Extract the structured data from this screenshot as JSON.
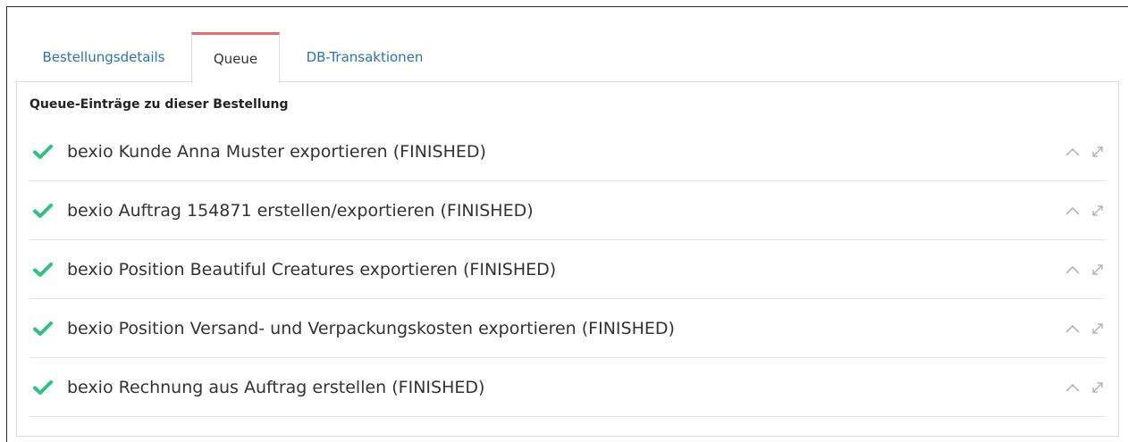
{
  "tabs": [
    {
      "label": "Bestellungsdetails",
      "active": false
    },
    {
      "label": "Queue",
      "active": true
    },
    {
      "label": "DB-Transaktionen",
      "active": false
    }
  ],
  "panel": {
    "title": "Queue-Einträge zu dieser Bestellung"
  },
  "queue": [
    {
      "label": "bexio Kunde Anna Muster exportieren (FINISHED)",
      "status_icon": "check-icon"
    },
    {
      "label": "bexio Auftrag 154871 erstellen/exportieren (FINISHED)",
      "status_icon": "check-icon"
    },
    {
      "label": "bexio Position Beautiful Creatures exportieren (FINISHED)",
      "status_icon": "check-icon"
    },
    {
      "label": "bexio Position Versand- und Verpackungskosten exportieren (FINISHED)",
      "status_icon": "check-icon"
    },
    {
      "label": "bexio Rechnung aus Auftrag erstellen (FINISHED)",
      "status_icon": "check-icon"
    }
  ],
  "colors": {
    "link": "#2a73b7",
    "active_tab_accent": "#ea6b6b",
    "success": "#2ec27e",
    "muted_icon": "#b5b5b5"
  }
}
